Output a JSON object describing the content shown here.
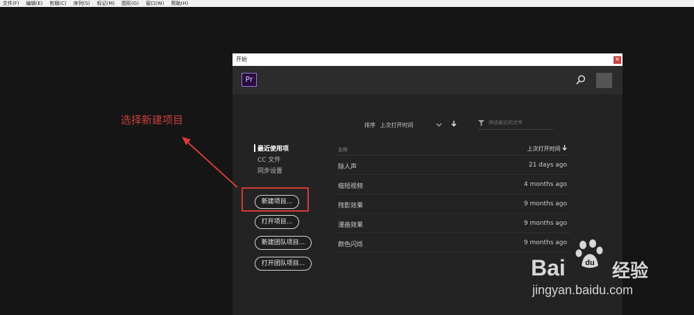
{
  "menu": {
    "items": [
      "文件(F)",
      "编辑(E)",
      "剪辑(C)",
      "序列(S)",
      "标记(M)",
      "图形(G)",
      "窗口(W)",
      "帮助(H)"
    ]
  },
  "dialog": {
    "title": "开始",
    "close_glyph": "×",
    "logo_text": "Pr",
    "header_icons": [
      "search-icon",
      "avatar-placeholder"
    ],
    "left_nav": [
      {
        "label": "最近使用项",
        "active": true
      },
      {
        "label": "CC 文件",
        "active": false
      },
      {
        "label": "同步设置",
        "active": false
      }
    ],
    "buttons": {
      "new_project": "新建项目...",
      "open_project": "打开项目...",
      "new_team_project": "新建团队项目...",
      "open_team_project": "打开团队项目..."
    },
    "sort": {
      "label": "排序",
      "value": "上次打开时间"
    },
    "filter_placeholder": "筛选最近的文件",
    "table": {
      "col_name": "名称",
      "col_last_opened": "上次打开时间",
      "rows": [
        {
          "name": "除人声",
          "time": "21 days ago"
        },
        {
          "name": "缩短视频",
          "time": "4 months ago"
        },
        {
          "name": "残影效果",
          "time": "9 months ago"
        },
        {
          "name": "漫画效果",
          "time": "9 months ago"
        },
        {
          "name": "颜色闪烁",
          "time": "9 months ago"
        }
      ]
    }
  },
  "annotation": {
    "text": "选择新建项目",
    "color": "#d63b36"
  },
  "watermark": {
    "bai": "Bai",
    "jingyan": "经验",
    "url": "jingyan.baidu.com"
  },
  "colors": {
    "accent_purple": "#9a7bd9",
    "background": "#151515",
    "dialog_bg": "#232323"
  }
}
